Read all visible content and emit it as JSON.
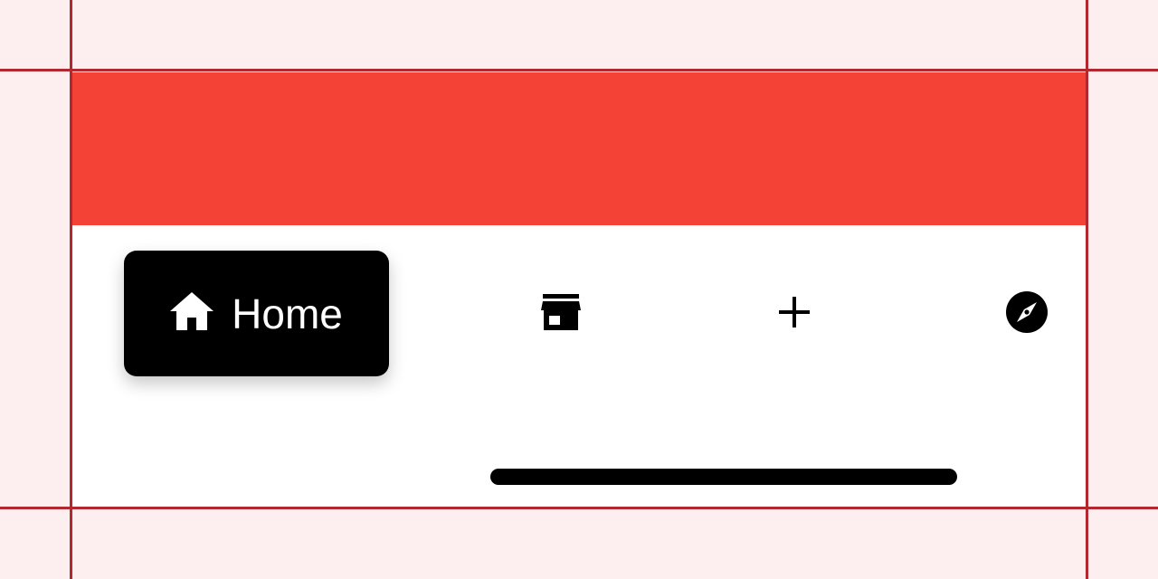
{
  "colors": {
    "header_band": "#F44336",
    "tabbar_background": "#FFFFFF",
    "active_tab_background": "#000000",
    "active_tab_foreground": "#FFFFFF",
    "icon_color": "#000000"
  },
  "tabbar": {
    "items": [
      {
        "id": "home",
        "icon": "home-icon",
        "label": "Home",
        "active": true
      },
      {
        "id": "store",
        "icon": "store-icon",
        "active": false
      },
      {
        "id": "add",
        "icon": "plus-icon",
        "active": false
      },
      {
        "id": "explore",
        "icon": "compass-icon",
        "active": false
      }
    ]
  }
}
